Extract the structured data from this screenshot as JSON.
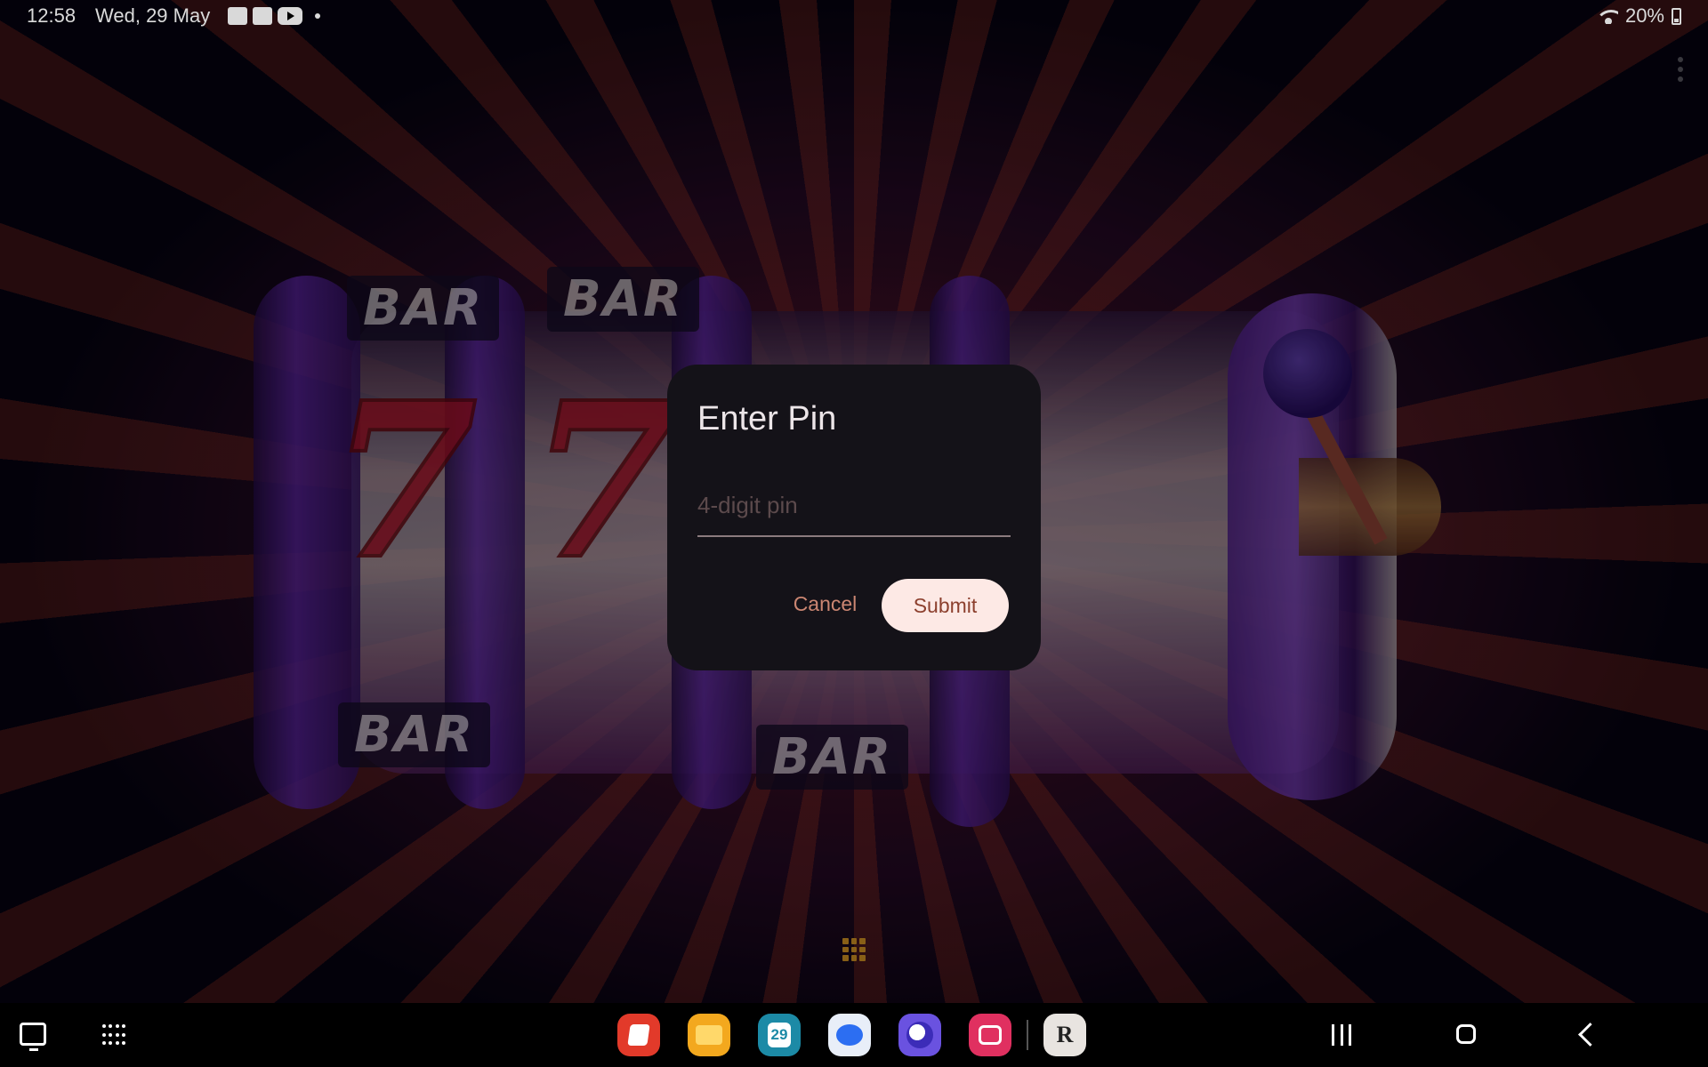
{
  "status_bar": {
    "time": "12:58",
    "date": "Wed, 29 May",
    "notification_icons": [
      "gallery-icon",
      "person-icon",
      "youtube-icon"
    ],
    "battery": "20%"
  },
  "wallpaper": {
    "reel_labels": [
      "BAR",
      "BAR",
      "BAR",
      "BAR"
    ],
    "symbol": "7"
  },
  "dialog": {
    "title": "Enter Pin",
    "pin_placeholder": "4-digit pin",
    "pin_value": "",
    "cancel_label": "Cancel",
    "submit_label": "Submit",
    "colors": {
      "surface": "#141218",
      "text_button": "#cb8672",
      "filled_button_bg": "#fde9e5",
      "filled_button_text": "#8c3f2d"
    }
  },
  "taskbar": {
    "left_icons": [
      "recent-apps-panel-icon",
      "app-drawer-icon"
    ],
    "dock_apps": [
      {
        "name": "Samsung Notes",
        "icon": "notes-icon"
      },
      {
        "name": "My Files",
        "icon": "folder-icon"
      },
      {
        "name": "Calendar",
        "icon": "calendar-icon",
        "badge": "29"
      },
      {
        "name": "Messages",
        "icon": "messages-icon"
      },
      {
        "name": "Samsung Internet",
        "icon": "internet-icon"
      },
      {
        "name": "Screen Recorder",
        "icon": "camera-icon"
      },
      {
        "name": "RA App",
        "icon": "ra-app-icon",
        "label": "R"
      }
    ],
    "nav": [
      "recents-button",
      "home-button",
      "back-button"
    ]
  }
}
